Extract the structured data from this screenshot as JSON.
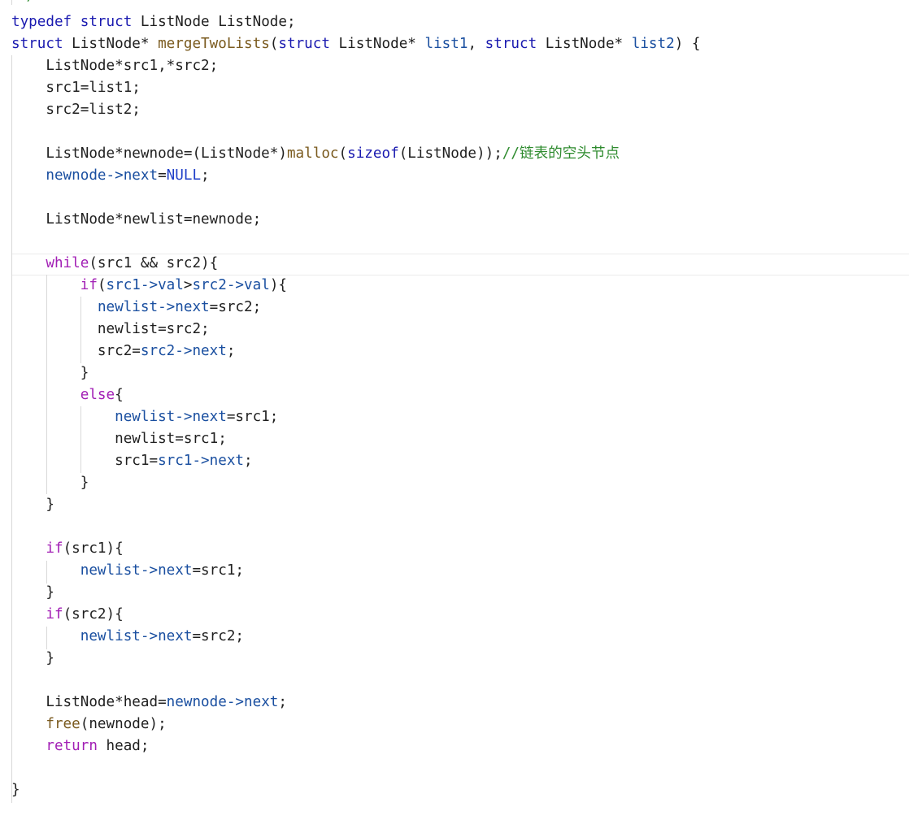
{
  "editor": {
    "language": "C",
    "colors": {
      "background": "#ffffff",
      "plain": "#1f1f1f",
      "keyword": "#1a1ab0",
      "control": "#a21fb5",
      "function": "#7a5a1e",
      "member": "#1a4fa0",
      "macro": "#1f3fc8",
      "comment": "#2e8b2e"
    },
    "cut_off_top_text": "*/",
    "lines": [
      [
        [
          "keyword",
          "typedef"
        ],
        [
          "plain",
          " "
        ],
        [
          "keyword",
          "struct"
        ],
        [
          "plain",
          " ListNode ListNode;"
        ]
      ],
      [
        [
          "keyword",
          "struct"
        ],
        [
          "plain",
          " ListNode* "
        ],
        [
          "func",
          "mergeTwoLists"
        ],
        [
          "plain",
          "("
        ],
        [
          "keyword",
          "struct"
        ],
        [
          "plain",
          " ListNode* "
        ],
        [
          "member",
          "list1"
        ],
        [
          "plain",
          ", "
        ],
        [
          "keyword",
          "struct"
        ],
        [
          "plain",
          " ListNode* "
        ],
        [
          "member",
          "list2"
        ],
        [
          "plain",
          ") {"
        ]
      ],
      [
        [
          "plain",
          "    ListNode*src1,*src2;"
        ]
      ],
      [
        [
          "plain",
          "    src1=list1;"
        ]
      ],
      [
        [
          "plain",
          "    src2=list2;"
        ]
      ],
      [],
      [
        [
          "plain",
          "    ListNode*newnode=(ListNode*)"
        ],
        [
          "func",
          "malloc"
        ],
        [
          "plain",
          "("
        ],
        [
          "keyword",
          "sizeof"
        ],
        [
          "plain",
          "(ListNode));"
        ],
        [
          "comment",
          "//链表的空头节点"
        ]
      ],
      [
        [
          "plain",
          "    "
        ],
        [
          "member",
          "newnode->next"
        ],
        [
          "plain",
          "="
        ],
        [
          "macro",
          "NULL"
        ],
        [
          "plain",
          ";"
        ]
      ],
      [],
      [
        [
          "plain",
          "    ListNode*newlist=newnode;"
        ]
      ],
      [],
      [
        [
          "plain",
          "    "
        ],
        [
          "control",
          "while"
        ],
        [
          "plain",
          "(src1 && src2){"
        ]
      ],
      [
        [
          "plain",
          "        "
        ],
        [
          "control",
          "if"
        ],
        [
          "plain",
          "("
        ],
        [
          "member",
          "src1->val"
        ],
        [
          "plain",
          ">"
        ],
        [
          "member",
          "src2->val"
        ],
        [
          "plain",
          "){"
        ]
      ],
      [
        [
          "plain",
          "          "
        ],
        [
          "member",
          "newlist->next"
        ],
        [
          "plain",
          "=src2;"
        ]
      ],
      [
        [
          "plain",
          "          newlist=src2;"
        ]
      ],
      [
        [
          "plain",
          "          src2="
        ],
        [
          "member",
          "src2->next"
        ],
        [
          "plain",
          ";"
        ]
      ],
      [
        [
          "plain",
          "        }"
        ]
      ],
      [
        [
          "plain",
          "        "
        ],
        [
          "control",
          "else"
        ],
        [
          "plain",
          "{"
        ]
      ],
      [
        [
          "plain",
          "            "
        ],
        [
          "member",
          "newlist->next"
        ],
        [
          "plain",
          "=src1;"
        ]
      ],
      [
        [
          "plain",
          "            newlist=src1;"
        ]
      ],
      [
        [
          "plain",
          "            src1="
        ],
        [
          "member",
          "src1->next"
        ],
        [
          "plain",
          ";"
        ]
      ],
      [
        [
          "plain",
          "        }"
        ]
      ],
      [
        [
          "plain",
          "    }"
        ]
      ],
      [],
      [
        [
          "plain",
          "    "
        ],
        [
          "control",
          "if"
        ],
        [
          "plain",
          "(src1){"
        ]
      ],
      [
        [
          "plain",
          "        "
        ],
        [
          "member",
          "newlist->next"
        ],
        [
          "plain",
          "=src1;"
        ]
      ],
      [
        [
          "plain",
          "    }"
        ]
      ],
      [
        [
          "plain",
          "    "
        ],
        [
          "control",
          "if"
        ],
        [
          "plain",
          "(src2){"
        ]
      ],
      [
        [
          "plain",
          "        "
        ],
        [
          "member",
          "newlist->next"
        ],
        [
          "plain",
          "=src2;"
        ]
      ],
      [
        [
          "plain",
          "    }"
        ]
      ],
      [],
      [
        [
          "plain",
          "    ListNode*head="
        ],
        [
          "member",
          "newnode->next"
        ],
        [
          "plain",
          ";"
        ]
      ],
      [
        [
          "plain",
          "    "
        ],
        [
          "func",
          "free"
        ],
        [
          "plain",
          "(newnode);"
        ]
      ],
      [
        [
          "plain",
          "    "
        ],
        [
          "control",
          "return"
        ],
        [
          "plain",
          " head;"
        ]
      ],
      [],
      [
        [
          "plain",
          "}"
        ]
      ]
    ]
  }
}
